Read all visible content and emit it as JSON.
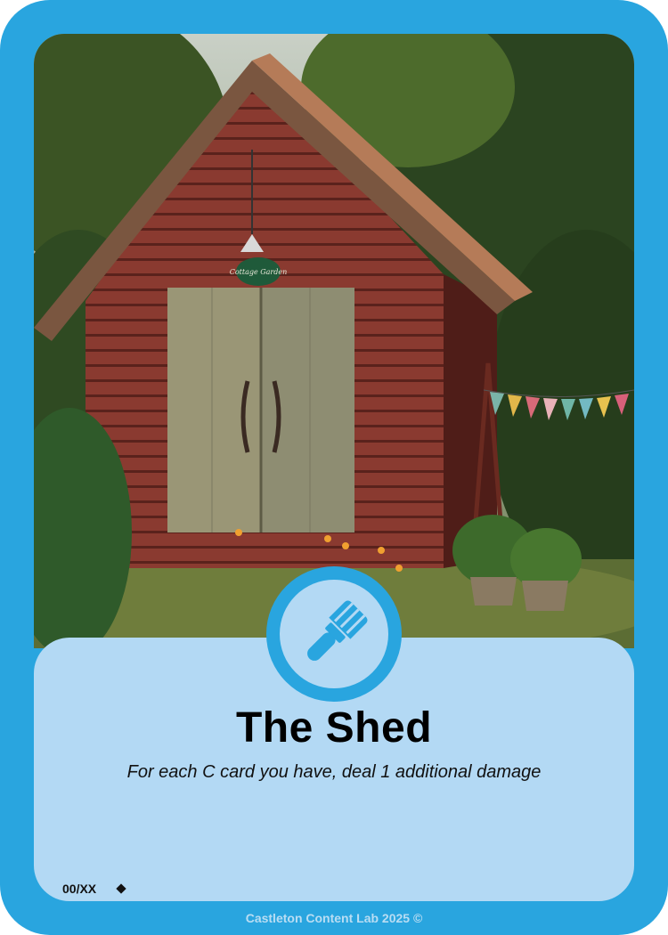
{
  "card": {
    "title": "The Shed",
    "description": "For each C card you have, deal 1 additional damage",
    "number": "00/XX",
    "footer": "Castleton Content Lab 2025 ©",
    "icon": "paintbrush-icon",
    "sign_text": "Cottage Garden",
    "colors": {
      "frame": "#29a5df",
      "panel": "#b3d9f4",
      "icon": "#29a5df"
    }
  }
}
